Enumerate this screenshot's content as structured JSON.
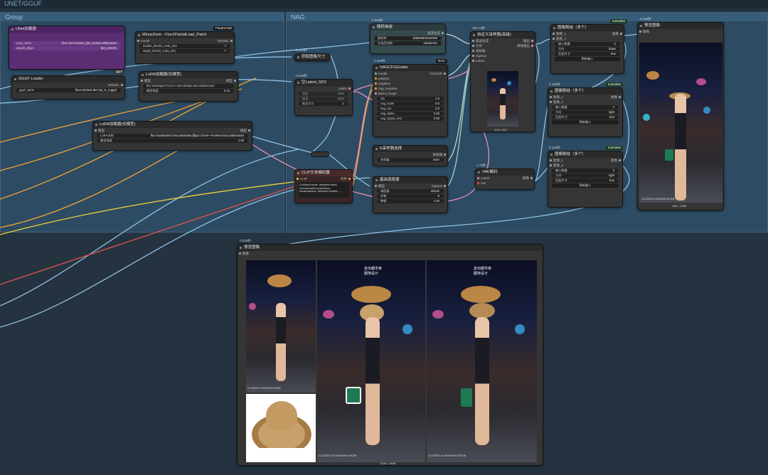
{
  "header": {
    "title": "UNET/GGUF"
  },
  "groups": {
    "left": "Group",
    "right": "NAG"
  },
  "colors": {
    "group_bg": "#2d4b62",
    "node_bg": "#353535",
    "wire_orange": "#f2a13a",
    "wire_yellow": "#f2d23a",
    "wire_pink": "#f08fb8",
    "wire_blue": "#8fc2e6",
    "wire_red": "#e2554a",
    "purple_node": "#5b2d72"
  },
  "nodes": {
    "unet_loader": {
      "title": "UNet加载器",
      "rows": [
        "unet_name",
        "weight_dtype"
      ],
      "values": [
        "flux1-dev-kontext_fp8_scaled.safetensors",
        "fp8_e4m3fn"
      ]
    },
    "gguf": {
      "badge": "gguf",
      "title": "GGUF Loader",
      "out": "MODEL",
      "widget_label": "gguf_name",
      "widget_value": "flux1-kontext-dev-Q4_K_S.gguf"
    },
    "minus": {
      "badge": "FluxExt-MZ",
      "title": "MinusZone - Flux1PartialLoad_Patch",
      "in": "model",
      "out": "MODEL",
      "w1": "double_blocks_cuda_size",
      "v1": "7",
      "w2": "single_blocks_cuda_size",
      "v2": "7"
    },
    "lora1": {
      "title": "LoRA加载器(仅模型)",
      "in": "模型",
      "out": "模型",
      "w1": "flux lora\\Hyper-FLUX.1-dev-8steps-lora.safetensors",
      "w2": "模型强度",
      "v2": "0.13"
    },
    "lora2": {
      "title": "LoRA加载器(仅模型)",
      "in": "模型",
      "out": "模型",
      "w1": "LoRA名称",
      "v1": "flux lora\\kontext lora wanxhaka 换put it here++kontext-lora.safetensors",
      "w2": "模型强度",
      "v2": "1.00"
    },
    "resize": {
      "timer": "0.153秒",
      "title": "获取图像尺寸"
    },
    "latent": {
      "timer": "0.049秒",
      "title": "空Latent_SD3",
      "out": "Latent",
      "w1": "宽度",
      "v1": "1024",
      "w2": "高度",
      "v2": "1024",
      "w3": "批次大小",
      "v3": "1"
    },
    "noise": {
      "timer": "0.006秒",
      "title": "随机噪波",
      "out": "噪波生成",
      "w1": "随机种",
      "v1": "169290806184396",
      "w2": "生成后控制",
      "v2": "randomize"
    },
    "nag": {
      "timer": "0.006秒",
      "badge": "NAG",
      "title": "NAGCFGGuider",
      "in": [
        "model",
        "positive",
        "negative",
        "nag_negative",
        "latent_image"
      ],
      "out": "GUIDER",
      "w": [
        "cfg",
        "nag_scale",
        "nag_tau",
        "nag_alpha",
        "nag_sigma_end"
      ],
      "v": [
        "1.0",
        "5.0",
        "2.5",
        "0.25",
        "0.50"
      ]
    },
    "sampler_sel": {
      "title": "K采样器选择",
      "out": "采样器",
      "w1": "采样器",
      "v1": "euler"
    },
    "scheduler": {
      "title": "基础调度器",
      "in": "模型",
      "out": "Sigmas",
      "w": [
        "调度器",
        "步数",
        "降噪"
      ],
      "v": [
        "simple",
        "8",
        "1.00"
      ]
    },
    "clip": {
      "title": "CLIP文本编码器",
      "in": "CLIP",
      "out": "条件",
      "text": "Crooked hands, distorted faces, unreasonable proportions, unnaturalness, distorted shapes, ..."
    },
    "custom_sampler": {
      "timer": "156.79秒",
      "title": "自定义采样器(高级)",
      "in": [
        "噪波生成",
        "引导",
        "采样器",
        "Sigmas",
        "Latent"
      ],
      "out": [
        "输出",
        "降噪输出"
      ],
      "size": "376 × 512"
    },
    "vae": {
      "timer": "1.79秒",
      "title": "VAE解码",
      "in": [
        "Latent",
        "vae"
      ],
      "out": "图像"
    },
    "stitch1": {
      "badge": "KJNodes",
      "title": "图像联结（多个）",
      "in": [
        "图像_1",
        "图像_2"
      ],
      "out": "图像",
      "w": [
        "输入数量",
        "方向",
        "匹配尺寸"
      ],
      "v": [
        "2",
        "down",
        "true"
      ],
      "btn": "更新输入"
    },
    "stitch2": {
      "timer": "0.155秒",
      "badge": "KJNodes",
      "title": "图像联结（多个）",
      "in": [
        "图像_1",
        "图像_2"
      ],
      "out": "图像",
      "w": [
        "输入数量",
        "方向",
        "匹配尺寸"
      ],
      "v": [
        "2",
        "right",
        "true"
      ],
      "btn": "更新输入"
    },
    "stitch3": {
      "timer": "0.154秒",
      "badge": "KJNodes",
      "title": "图像联结（多个）",
      "in": [
        "图像_1",
        "图像_2"
      ],
      "out": "图像",
      "w": [
        "输入数量",
        "方向",
        "匹配尺寸"
      ],
      "v": [
        "2",
        "right",
        "true"
      ],
      "btn": "更新输入"
    },
    "preview_right": {
      "timer": "0.166秒",
      "title": "预览图像",
      "in": "图像",
      "size": "768 × 1408",
      "caption": "CLOSER AI FASHION SHOW"
    },
    "preview_bottom": {
      "timer": "0.529秒",
      "title": "预览图像",
      "in": "图像",
      "size": "2146 × 2160",
      "caption1": "CLOSER AI FASHION SHOW",
      "caption2": "CLOSER AI FASHION SHOW",
      "caption3": "CLOSER AI FASHION SHOW",
      "sign": "走出都市夜\n服饰设计"
    }
  }
}
